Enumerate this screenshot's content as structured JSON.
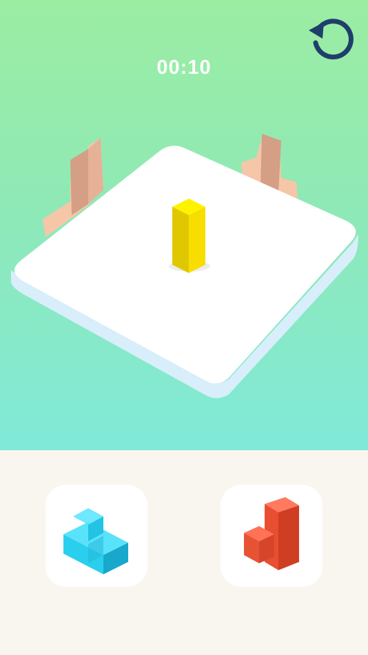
{
  "timer": {
    "value": "00:10"
  },
  "colors": {
    "background_top": "#9bedA2",
    "background_bottom": "#80e9d8",
    "board": "#ffffff",
    "target_block": "#f4d800",
    "piece_blue": "#33d6f0",
    "piece_red": "#f25a3c",
    "restart_icon": "#1f3f6b",
    "tray": "#f9f6ef"
  },
  "pieces": [
    {
      "name": "cyan-l-piece",
      "color": "cyan"
    },
    {
      "name": "red-l-piece",
      "color": "red"
    }
  ],
  "icons": {
    "restart": "restart-icon"
  }
}
